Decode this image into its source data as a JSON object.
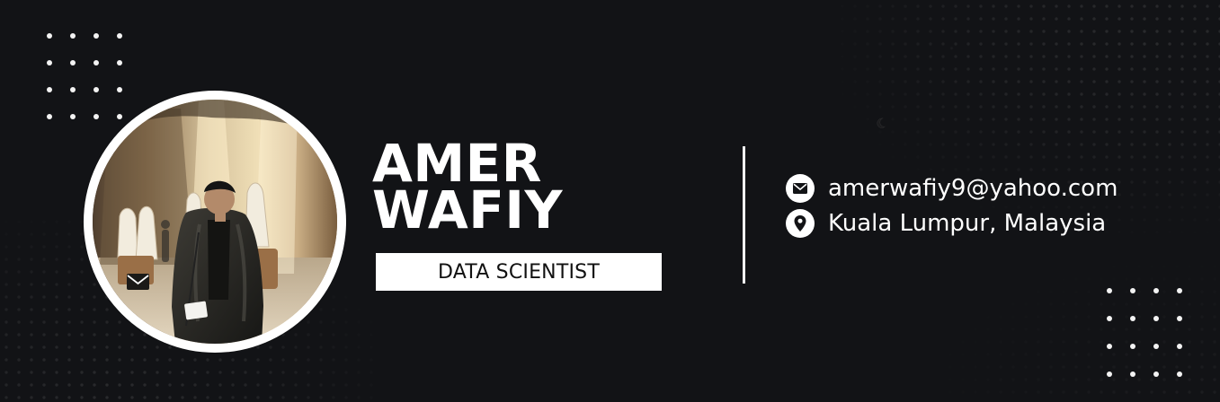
{
  "profile": {
    "name_lines": [
      "AMER",
      "WAFIY"
    ],
    "title": "DATA SCIENTIST",
    "email": "amerwafiy9@yahoo.com",
    "location": "Kuala Lumpur, Malaysia"
  },
  "icons": {
    "email": "mail-icon",
    "location": "location-pin-icon",
    "photo_overlay": "envelope-icon"
  },
  "colors": {
    "background": "#121316",
    "foreground": "#ffffff",
    "accent": "#ffffff"
  }
}
